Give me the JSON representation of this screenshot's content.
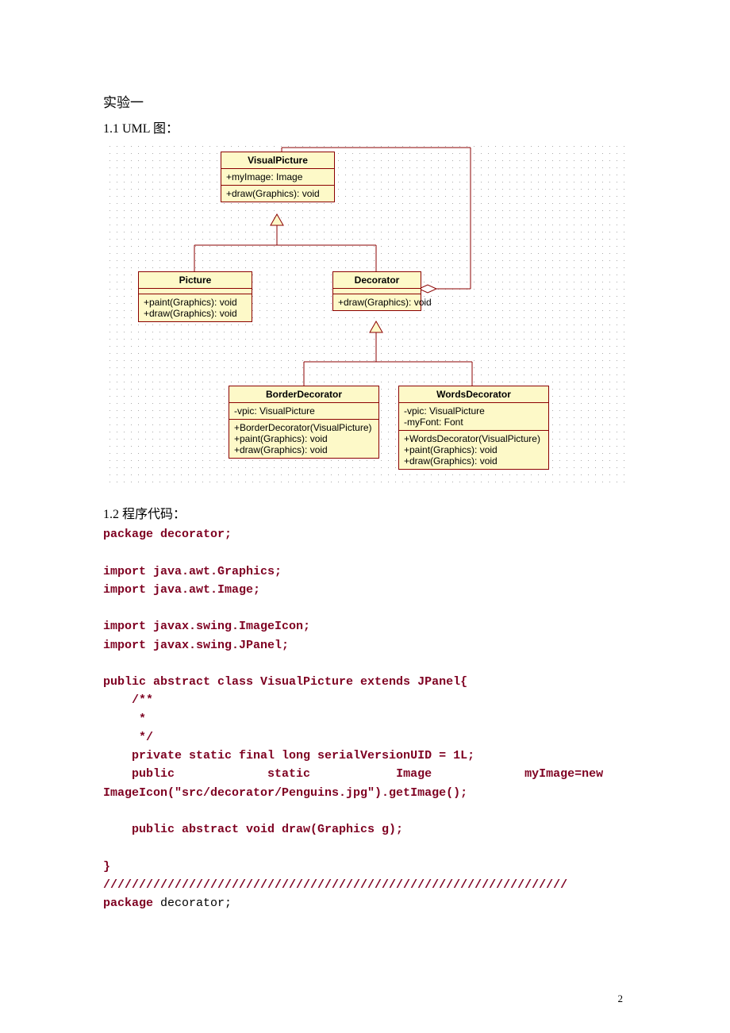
{
  "headings": {
    "experiment": "实验一",
    "uml": "1.1 UML 图：",
    "code": "1.2 程序代码："
  },
  "uml": {
    "visualPicture": {
      "name": "VisualPicture",
      "attr": "+myImage: Image",
      "op": "+draw(Graphics): void"
    },
    "picture": {
      "name": "Picture",
      "op1": "+paint(Graphics): void",
      "op2": "+draw(Graphics): void"
    },
    "decorator": {
      "name": "Decorator",
      "op": "+draw(Graphics): void"
    },
    "borderDecorator": {
      "name": "BorderDecorator",
      "a1": "-vpic: VisualPicture",
      "o1": "+BorderDecorator(VisualPicture)",
      "o2": "+paint(Graphics): void",
      "o3": "+draw(Graphics): void"
    },
    "wordsDecorator": {
      "name": "WordsDecorator",
      "a1": "-vpic: VisualPicture",
      "a2": "-myFont: Font",
      "o1": "+WordsDecorator(VisualPicture)",
      "o2": "+paint(Graphics): void",
      "o3": "+draw(Graphics): void"
    }
  },
  "code": {
    "l1": "package decorator;",
    "l2": "import java.awt.Graphics;",
    "l3": "import java.awt.Image;",
    "l4": "import javax.swing.ImageIcon;",
    "l5": "import javax.swing.JPanel;",
    "l6": "public abstract class VisualPicture extends JPanel{",
    "l7": "    /**",
    "l8": "     * ",
    "l9": "     */",
    "l10": "    private static final long serialVersionUID = 1L;",
    "l11a": "    public",
    "l11b": "static",
    "l11c": "Image",
    "l11d": "myImage=new",
    "l12": "ImageIcon(\"src/decorator/Penguins.jpg\").getImage();",
    "l13": "    public abstract void draw(Graphics g);",
    "l14": "}",
    "l15": "/////////////////////////////////////////////////////////////////",
    "l16a": "package",
    "l16b": " decorator;"
  },
  "pageNumber": "2"
}
